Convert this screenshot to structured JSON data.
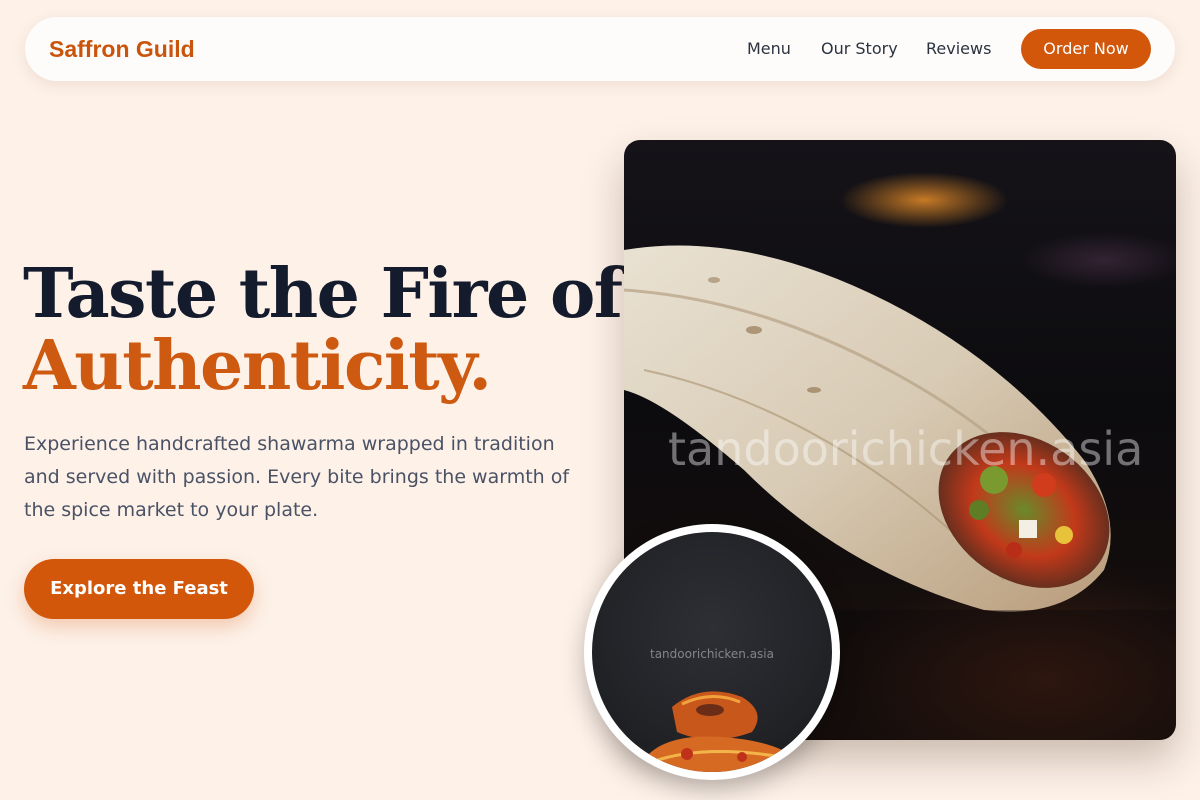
{
  "brand": {
    "name": "Saffron Guild"
  },
  "nav": {
    "links": [
      {
        "label": "Menu"
      },
      {
        "label": "Our Story"
      },
      {
        "label": "Reviews"
      }
    ],
    "cta_label": "Order Now"
  },
  "hero": {
    "headline_line1": "Taste the Fire of",
    "headline_line2": "Authenticity.",
    "description": "Experience handcrafted shawarma wrapped in tradition and served with passion. Every bite brings the warmth of the spice market to your plate.",
    "cta_label": "Explore the Feast"
  },
  "images": {
    "main_watermark": "tandoorichicken.asia",
    "circle_watermark": "tandoorichicken.asia"
  },
  "colors": {
    "accent": "#d2570a",
    "background": "#fdf1e8",
    "headline_dark": "#141b2d"
  }
}
